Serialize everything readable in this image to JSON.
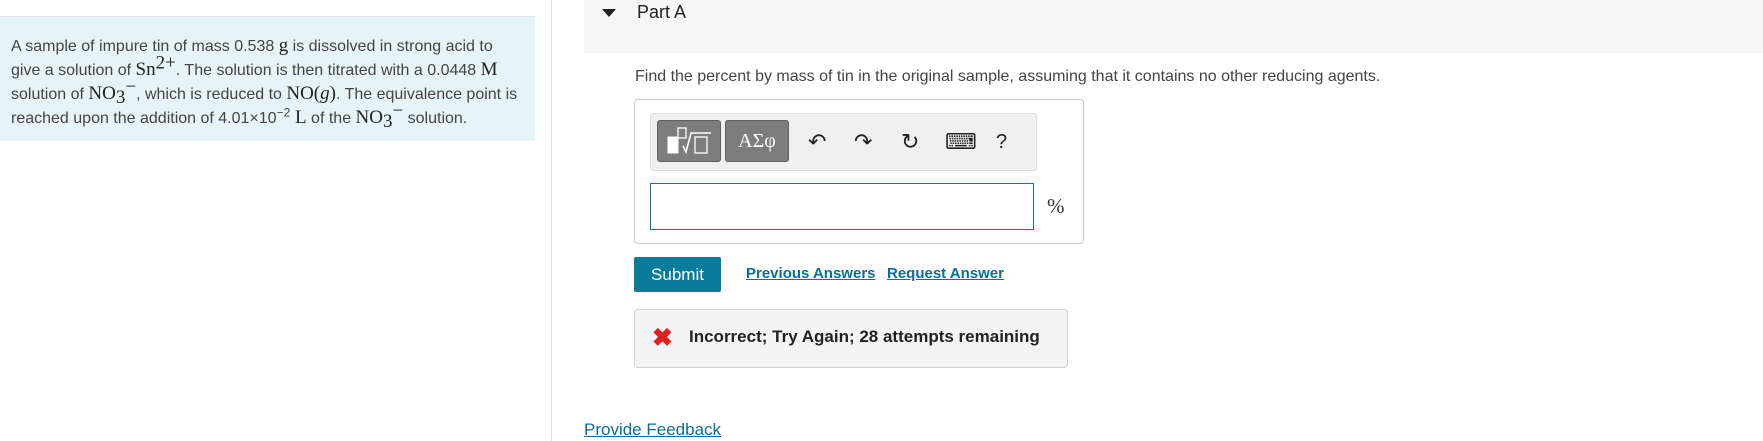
{
  "problem": {
    "t1": "A sample of impure tin of mass 0.538 ",
    "g": "g",
    "t2": " is dissolved in strong acid to give a solution of ",
    "sn": "Sn",
    "sn_charge": "2+",
    "t3": ". The solution is then titrated with a 0.0448 ",
    "M": "M",
    "t4": " solution of ",
    "no": "NO",
    "no3_sub": "3",
    "no3_charge": "−",
    "t5": ", which is reduced to ",
    "nog": "NO(",
    "nog_g": "g",
    "nog_close": ")",
    "t6": ". The equivalence point is reached upon the addition of 4.01×10",
    "exp": "−2",
    "L": " L",
    "t7": " of the ",
    "t8": " solution."
  },
  "part": {
    "title": "Part A"
  },
  "prompt": "Find the percent by mass of tin in the original sample, assuming that it contains no other reducing agents.",
  "toolbar": {
    "greek_label": "ΑΣφ",
    "undo_glyph": "↶",
    "redo_glyph": "↷",
    "reset_glyph": "↻",
    "keyboard_glyph": "⌨",
    "help_label": "?"
  },
  "answer": {
    "value": "",
    "unit": "%"
  },
  "actions": {
    "submit": "Submit",
    "previous_answers": "Previous Answers",
    "request_answer": "Request Answer"
  },
  "feedback": {
    "icon": "✖",
    "message": "Incorrect; Try Again; 28 attempts remaining"
  },
  "footer": {
    "provide_feedback": "Provide Feedback"
  },
  "colors": {
    "accent": "#0a7c9b",
    "error": "#e0201b",
    "problem_bg": "#e6f4f6"
  }
}
